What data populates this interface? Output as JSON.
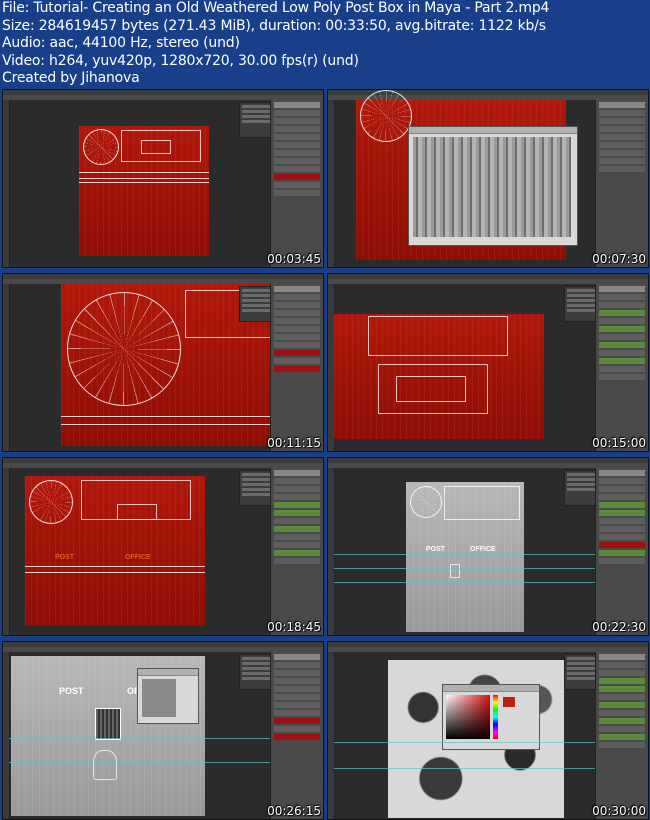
{
  "info": {
    "file": "File: Tutorial- Creating an Old Weathered Low Poly Post Box in Maya - Part 2.mp4",
    "size": "Size: 284619457 bytes (271.43 MiB), duration: 00:33:50, avg.bitrate: 1122 kb/s",
    "audio": "Audio: aac, 44100 Hz, stereo (und)",
    "video": "Video: h264, yuv420p, 1280x720, 30.00 fps(r) (und)",
    "creator": "Created by Jihanova"
  },
  "thumbnails": [
    {
      "timestamp": "00:03:45"
    },
    {
      "timestamp": "00:07:30"
    },
    {
      "timestamp": "00:11:15"
    },
    {
      "timestamp": "00:15:00"
    },
    {
      "timestamp": "00:18:45",
      "labels": {
        "post": "POST",
        "office": "OFFICE"
      }
    },
    {
      "timestamp": "00:22:30",
      "labels": {
        "post": "POST",
        "office": "OFFICE"
      }
    },
    {
      "timestamp": "00:26:15",
      "labels": {
        "post": "POST",
        "office": "OFFI"
      }
    },
    {
      "timestamp": "00:30:00"
    }
  ]
}
